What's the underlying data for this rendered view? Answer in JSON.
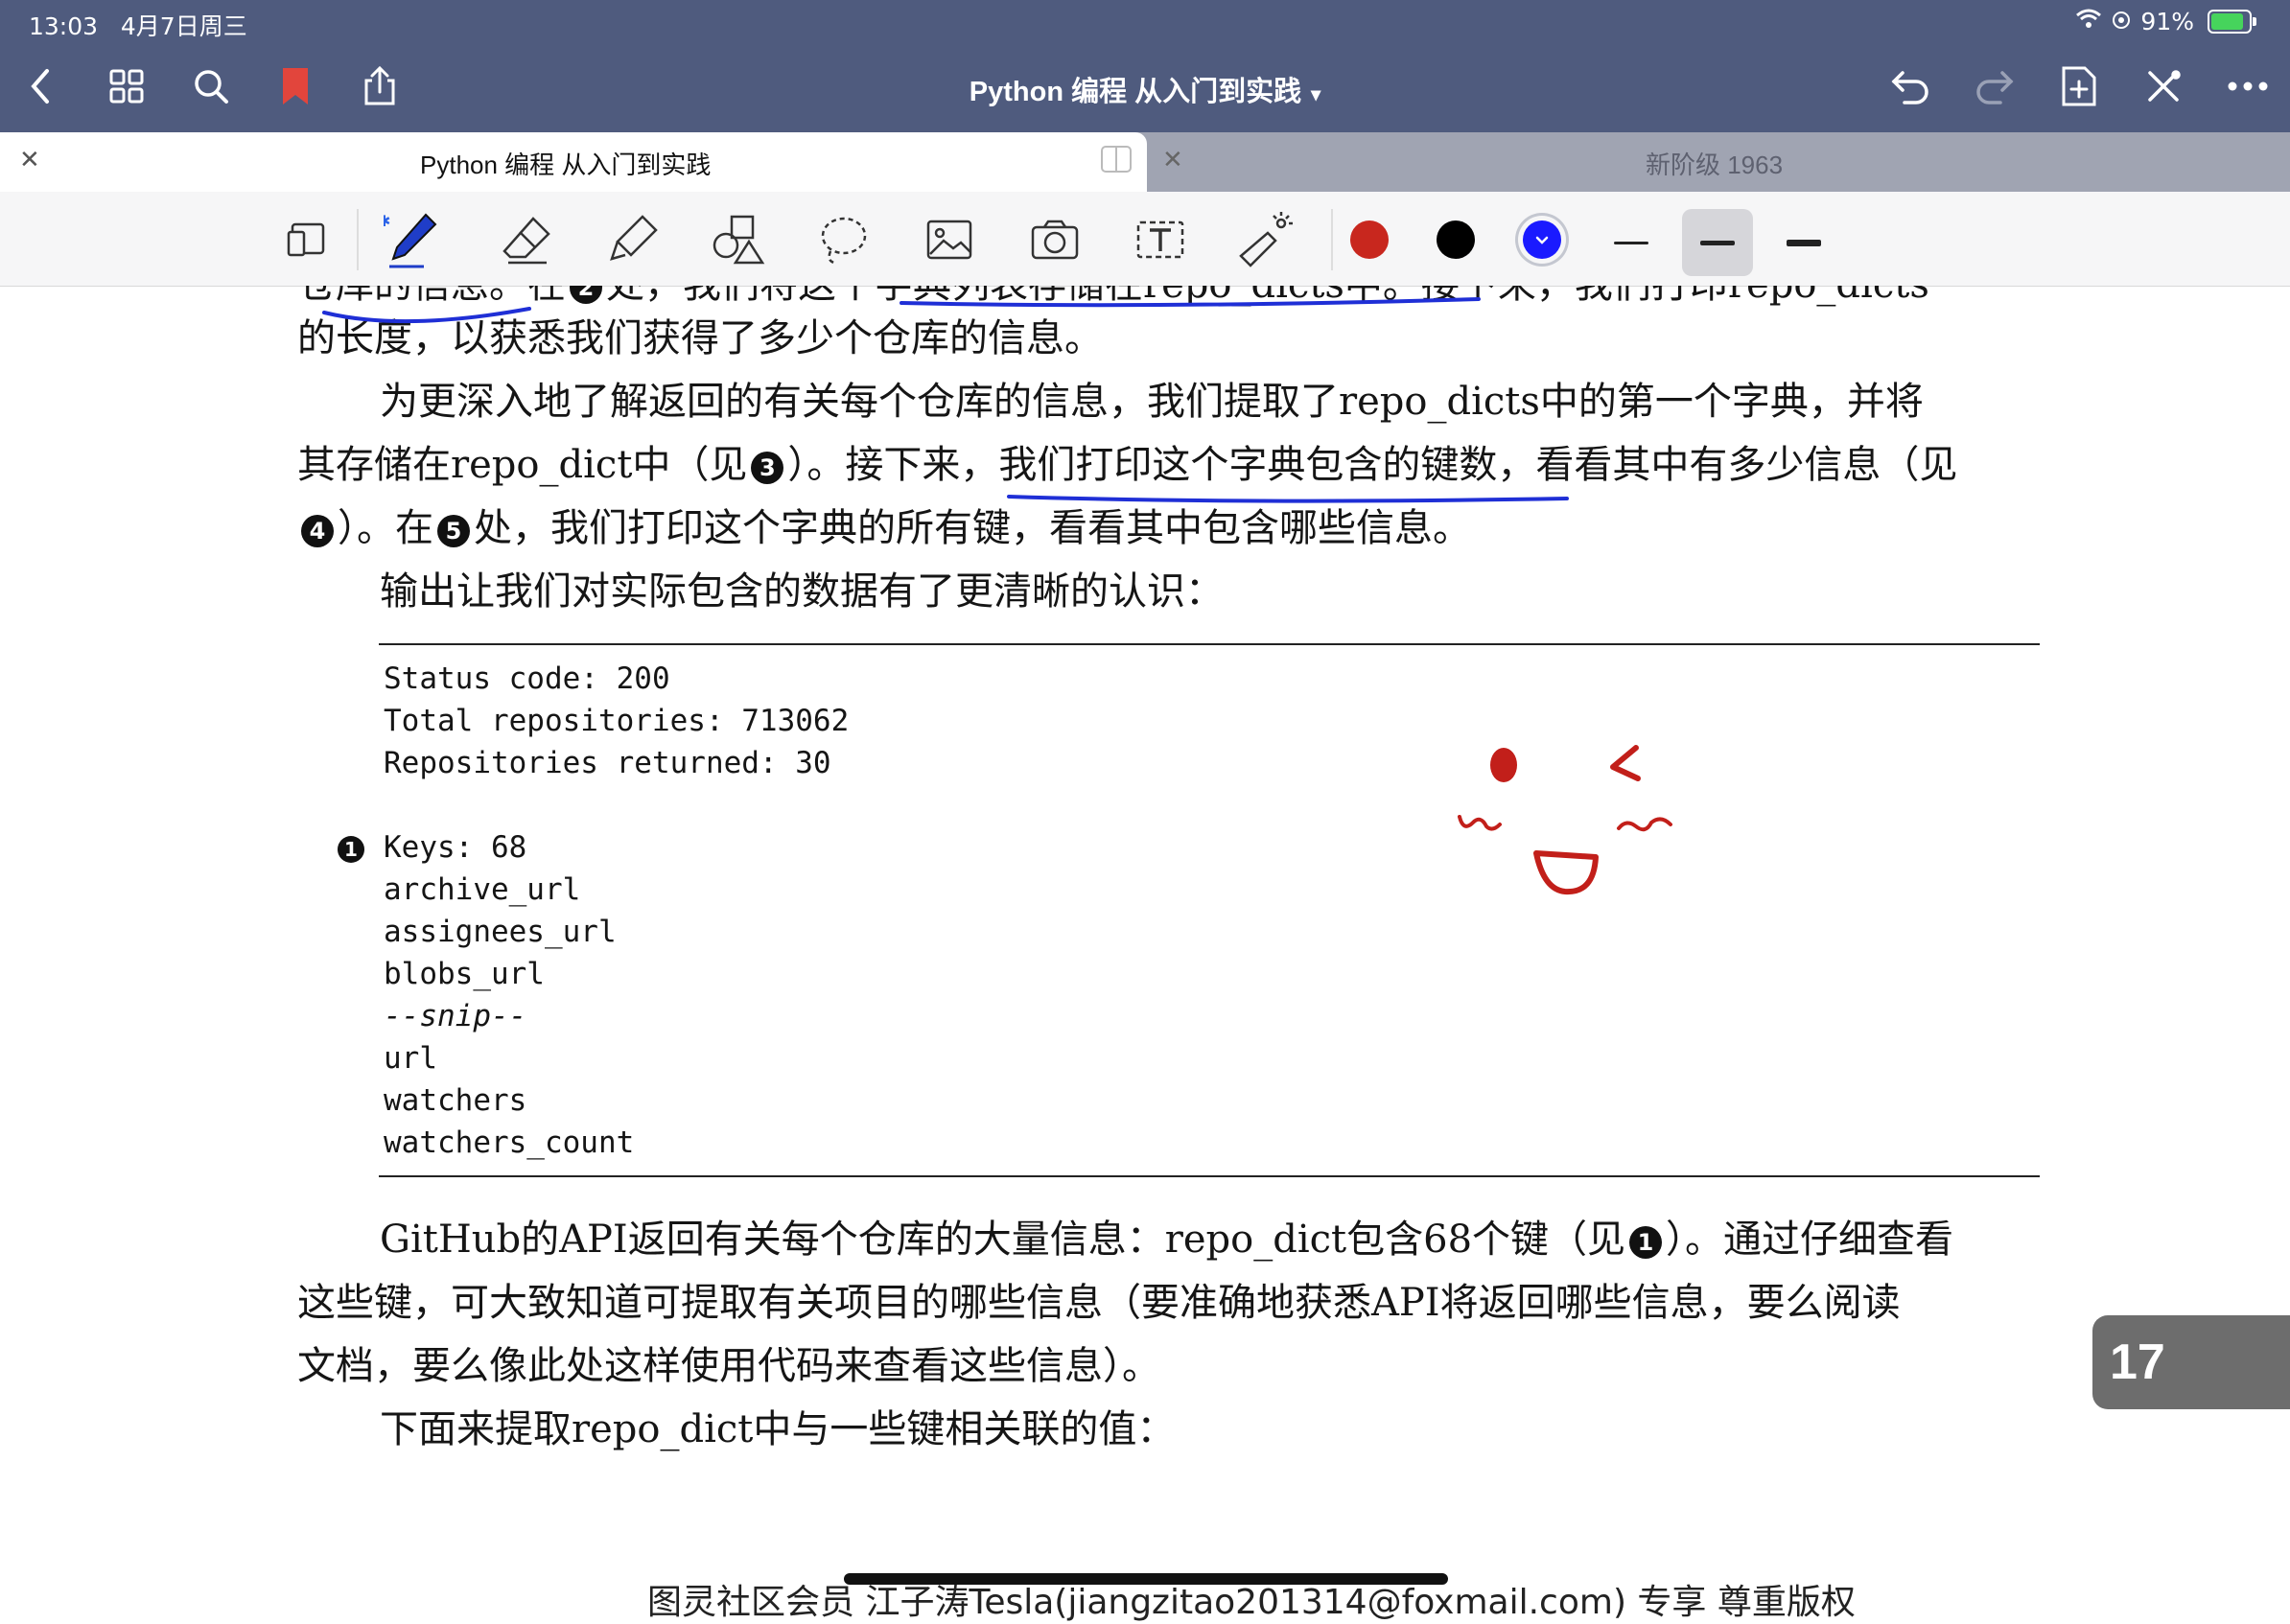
{
  "status": {
    "time": "13:03",
    "date": "4月7日周三",
    "battery": "91%"
  },
  "nav": {
    "title": "Python 编程  从入门到实践"
  },
  "tabs": [
    {
      "title": "Python 编程  从入门到实践",
      "active": true
    },
    {
      "title": "新阶级 1963",
      "active": false
    }
  ],
  "toolbar": {
    "colors": [
      "#c8271e",
      "#000000",
      "#1a1aff"
    ],
    "selected_color": "#1a1aff"
  },
  "page": {
    "lines": [
      "仓库的信息。在❷处，我们将这个字典列表存储在repo_dicts中。接下来，我们打印repo_dicts",
      "的长度，以获悉我们获得了多少个仓库的信息。",
      "为更深入地了解返回的有关每个仓库的信息，我们提取了repo_dicts中的第一个字典，并将",
      "其存储在repo_dict中（见❸）。接下来，我们打印这个字典包含的键数，看看其中有多少信息（见",
      "❹）。在❺处，我们打印这个字典的所有键，看看其中包含哪些信息。",
      "输出让我们对实际包含的数据有了更清晰的认识：",
      "GitHub的API返回有关每个仓库的大量信息：repo_dict包含68个键（见❶）。通过仔细查看",
      "这些键，可大致知道可提取有关项目的哪些信息（要准确地获悉API将返回哪些信息，要么阅读",
      "文档，要么像此处这样使用代码来查看这些信息）。",
      "下面来提取repo_dict中与一些键相关联的值："
    ],
    "code": [
      "Status code: 200",
      "Total repositories: 713062",
      "Repositories returned: 30",
      "",
      "Keys: 68",
      "archive_url",
      "assignees_url",
      "blobs_url",
      "--snip--",
      "url",
      "watchers",
      "watchers_count"
    ],
    "code_badge": "1",
    "page_number": "17",
    "footer": "图灵社区会员 江子涛Tesla(jiangzitao201314@foxmail.com) 专享 尊重版权"
  }
}
